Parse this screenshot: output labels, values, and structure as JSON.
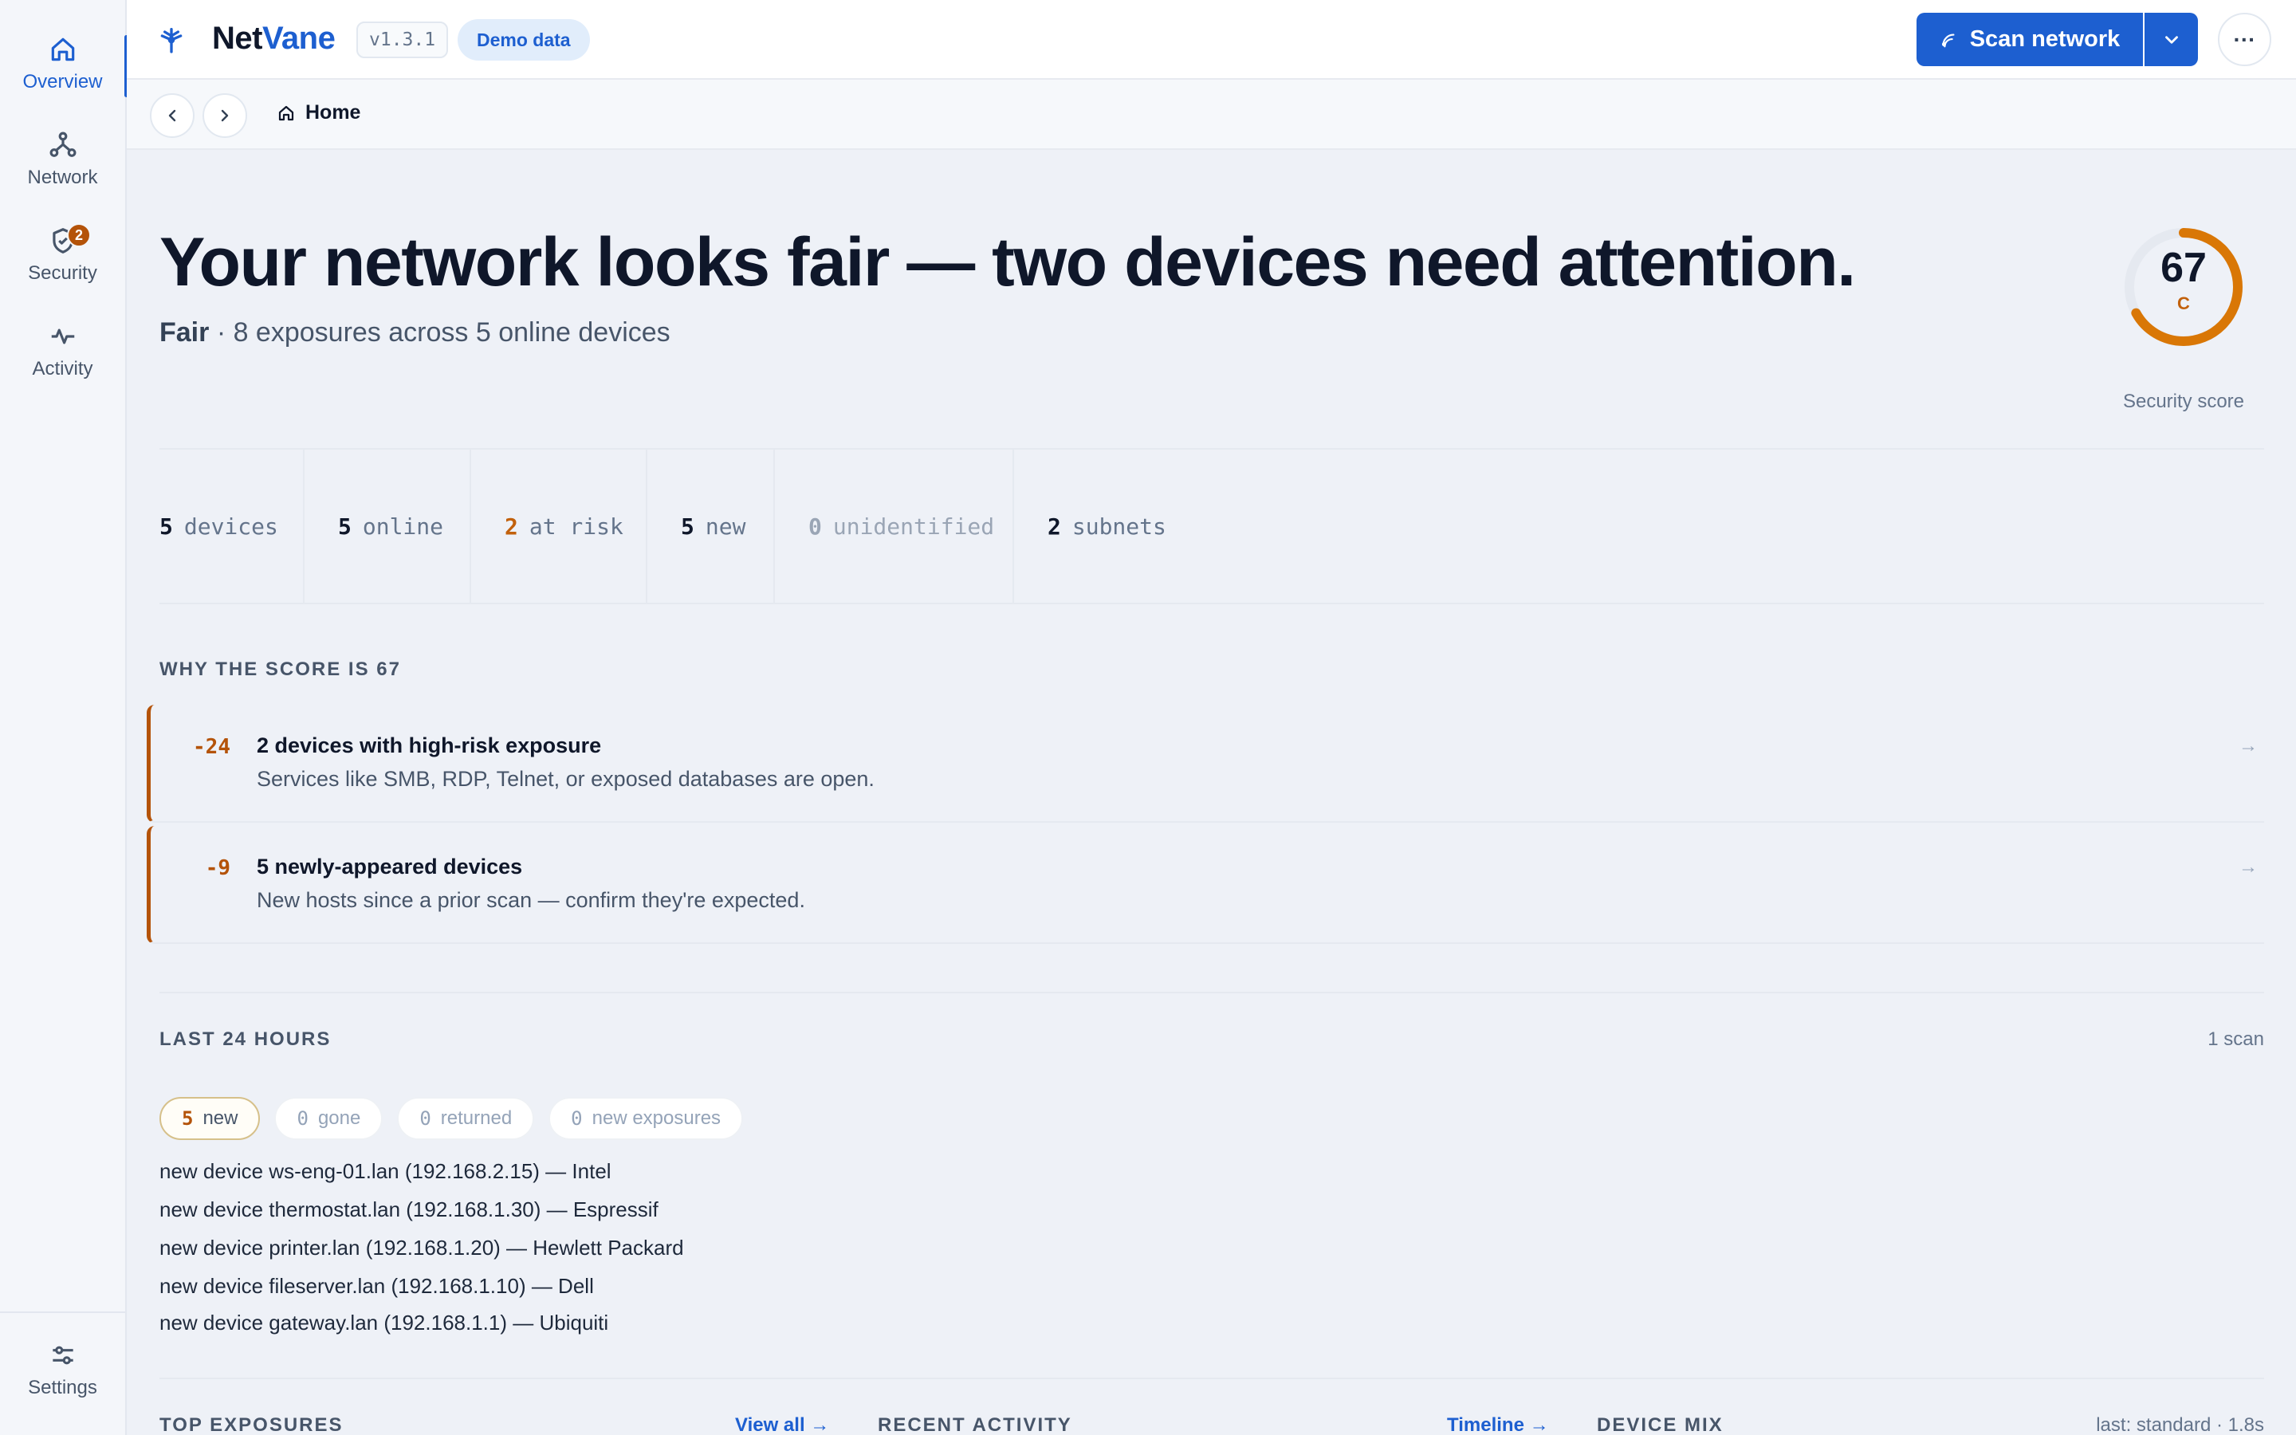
{
  "app": {
    "name_prefix": "Net",
    "name_accent": "Vane",
    "version": "v1.3.1",
    "demo_label": "Demo data"
  },
  "sidebar": {
    "items": [
      {
        "label": "Overview",
        "icon": "home-icon",
        "active": true
      },
      {
        "label": "Network",
        "icon": "network-icon"
      },
      {
        "label": "Security",
        "icon": "shield-icon",
        "badge": "2"
      },
      {
        "label": "Activity",
        "icon": "activity-icon"
      }
    ],
    "settings_label": "Settings"
  },
  "toolbar": {
    "scan_label": "Scan network",
    "more_label": "···"
  },
  "breadcrumb": {
    "label": "Home"
  },
  "hero": {
    "headline": "Your network looks fair — two devices need attention.",
    "status": "Fair",
    "summary": "· 8 exposures across 5 online devices"
  },
  "score": {
    "value": 67,
    "grade": "C",
    "label": "Security score",
    "fraction": 0.67,
    "color": "#d97706"
  },
  "stats": [
    {
      "value": "5",
      "label": "devices"
    },
    {
      "value": "5",
      "label": "online"
    },
    {
      "value": "2",
      "label": "at risk"
    },
    {
      "value": "5",
      "label": "new"
    },
    {
      "value": "0",
      "label": "unidentified"
    },
    {
      "value": "2",
      "label": "subnets"
    }
  ],
  "why": {
    "heading": "WHY THE SCORE IS 67",
    "reasons": [
      {
        "delta": "-24",
        "title": "2 devices with high-risk exposure",
        "desc": "Services like SMB, RDP, Telnet, or exposed databases are open.",
        "arrow": "→"
      },
      {
        "delta": "-9",
        "title": "5 newly-appeared devices",
        "desc": "New hosts since a prior scan — confirm they're expected.",
        "arrow": "→"
      }
    ]
  },
  "last24": {
    "heading": "LAST 24 HOURS",
    "scan_count": "1 scan",
    "chips": [
      {
        "n": "5",
        "label": "new"
      },
      {
        "n": "0",
        "label": "gone"
      },
      {
        "n": "0",
        "label": "returned"
      },
      {
        "n": "0",
        "label": "new exposures"
      }
    ],
    "events": [
      "new device ws-eng-01.lan (192.168.2.15) — Intel",
      "new device thermostat.lan (192.168.1.30) — Espressif",
      "new device printer.lan (192.168.1.20) — Hewlett Packard",
      "new device fileserver.lan (192.168.1.10) — Dell",
      "new device gateway.lan (192.168.1.1) — Ubiquiti"
    ]
  },
  "bottom": {
    "exposures_heading": "TOP EXPOSURES",
    "exposures_link": "View all →",
    "activity_heading": "RECENT ACTIVITY",
    "activity_link": "Timeline →",
    "mix_heading": "DEVICE MIX",
    "mix_meta": "last: standard · 1.8s"
  }
}
